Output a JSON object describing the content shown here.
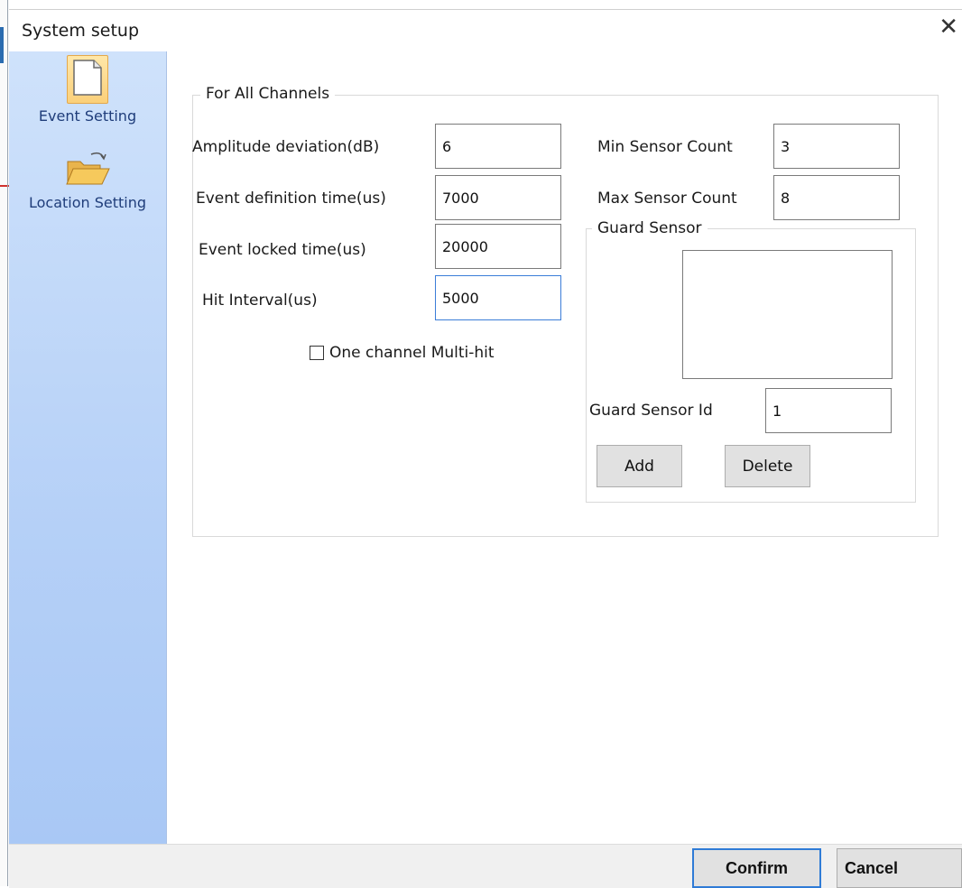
{
  "window": {
    "title": "System setup",
    "close_glyph": "✕"
  },
  "sidebar": {
    "items": [
      {
        "label": "Event Setting",
        "icon": "document-icon",
        "selected": true
      },
      {
        "label": "Location Setting",
        "icon": "open-folder-icon",
        "selected": false
      }
    ]
  },
  "all_channels": {
    "legend": "For All Channels",
    "amplitude_deviation": {
      "label": "Amplitude deviation(dB)",
      "value": "6"
    },
    "event_definition_time": {
      "label": "Event definition time(us)",
      "value": "7000"
    },
    "event_locked_time": {
      "label": "Event locked time(us)",
      "value": "20000"
    },
    "hit_interval": {
      "label": "Hit Interval(us)",
      "value": "5000"
    },
    "min_sensor_count": {
      "label": "Min Sensor Count",
      "value": "3"
    },
    "max_sensor_count": {
      "label": "Max Sensor Count",
      "value": "8"
    },
    "one_channel_multihit": {
      "label": "One channel Multi-hit",
      "checked": false
    }
  },
  "guard_sensor": {
    "legend": "Guard Sensor",
    "list_items": [],
    "id_field": {
      "label": "Guard Sensor Id",
      "value": "1"
    },
    "add_label": "Add",
    "delete_label": "Delete"
  },
  "footer": {
    "confirm_label": "Confirm",
    "cancel_label": "Cancel"
  },
  "colors": {
    "sidebar_top": "#cfe2fb",
    "sidebar_bottom": "#a9c8f5",
    "focus_border": "#3b7dd8",
    "confirm_border": "#2f7bd6"
  }
}
